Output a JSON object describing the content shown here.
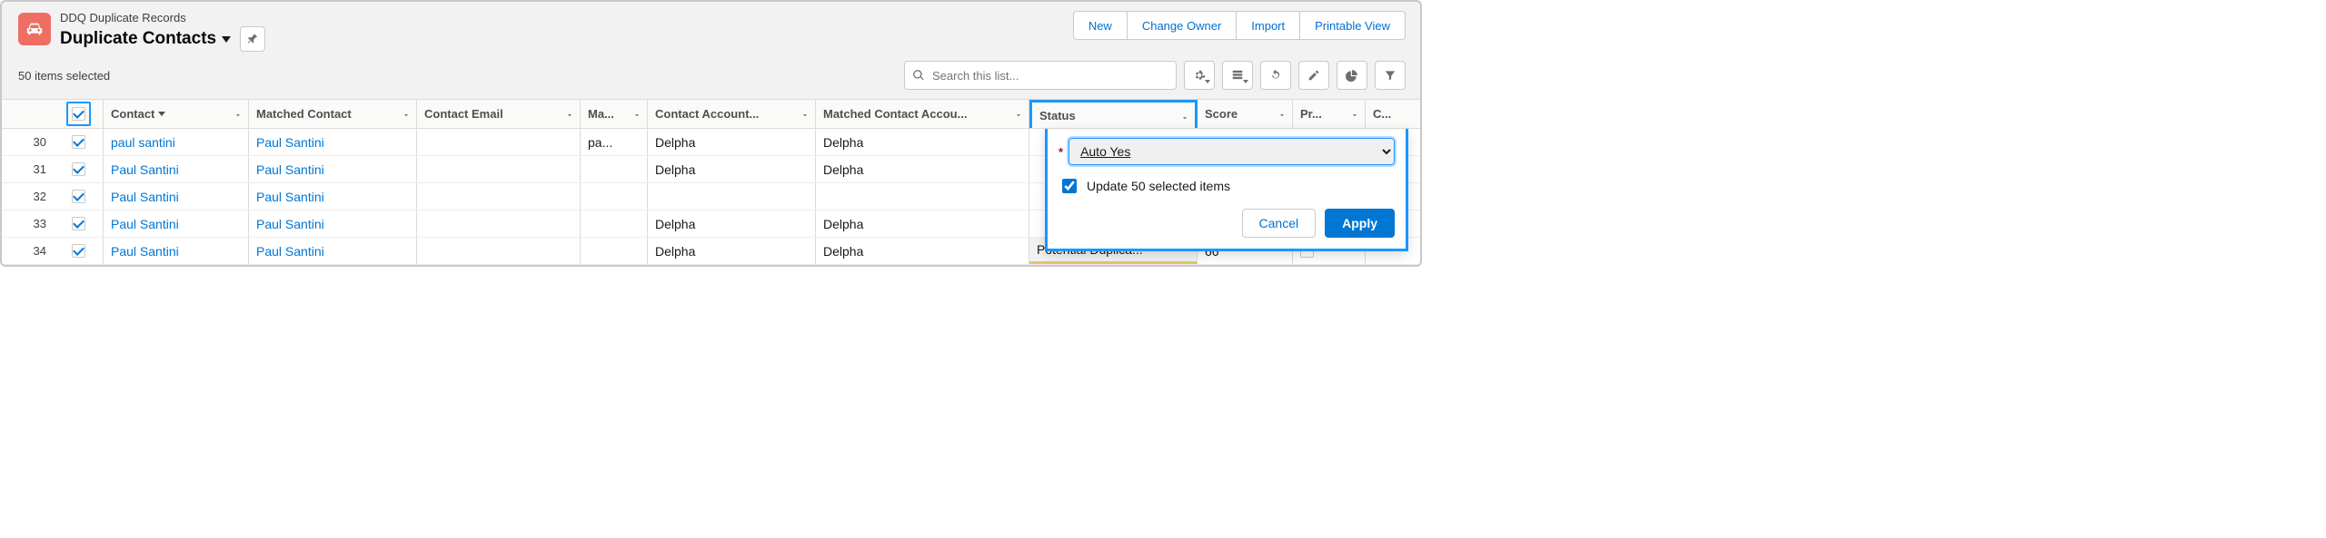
{
  "header": {
    "object_label": "DDQ Duplicate Records",
    "list_name": "Duplicate Contacts",
    "actions": {
      "new": "New",
      "change_owner": "Change Owner",
      "import": "Import",
      "printable_view": "Printable View"
    }
  },
  "subheader": {
    "selected_text": "50 items selected",
    "search_placeholder": "Search this list..."
  },
  "columns": {
    "contact": "Contact",
    "matched_contact": "Matched Contact",
    "contact_email": "Contact Email",
    "ma": "Ma...",
    "contact_account": "Contact Account...",
    "matched_contact_account": "Matched Contact Accou...",
    "status": "Status",
    "score": "Score",
    "pr": "Pr...",
    "c": "C..."
  },
  "rows": [
    {
      "num": "30",
      "contact": "paul santini",
      "matched": "Paul Santini",
      "email": "",
      "ma": "pa...",
      "account": "Delpha",
      "maccount": "Delpha",
      "status": "",
      "score": ""
    },
    {
      "num": "31",
      "contact": "Paul Santini",
      "matched": "Paul Santini",
      "email": "",
      "ma": "",
      "account": "Delpha",
      "maccount": "Delpha",
      "status": "",
      "score": ""
    },
    {
      "num": "32",
      "contact": "Paul Santini",
      "matched": "Paul Santini",
      "email": "",
      "ma": "",
      "account": "",
      "maccount": "",
      "status": "",
      "score": ""
    },
    {
      "num": "33",
      "contact": "Paul Santini",
      "matched": "Paul Santini",
      "email": "",
      "ma": "",
      "account": "Delpha",
      "maccount": "Delpha",
      "status": "",
      "score": ""
    },
    {
      "num": "34",
      "contact": "Paul Santini",
      "matched": "Paul Santini",
      "email": "",
      "ma": "",
      "account": "Delpha",
      "maccount": "Delpha",
      "status": "Potential Duplica...",
      "score": "66"
    }
  ],
  "popover": {
    "select_value": "Auto Yes",
    "update_label": "Update 50 selected items",
    "cancel": "Cancel",
    "apply": "Apply"
  }
}
